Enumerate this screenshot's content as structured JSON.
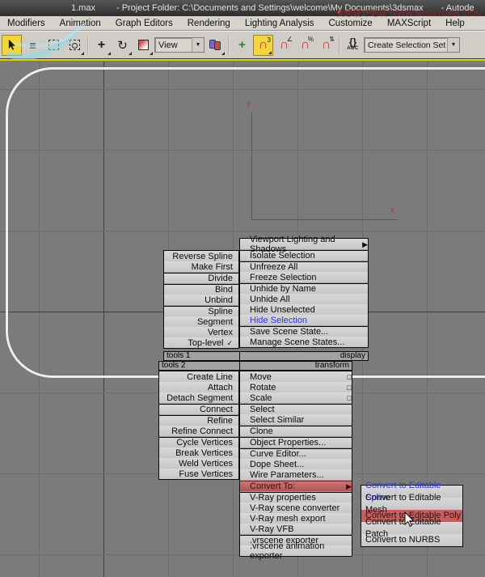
{
  "title_bar": {
    "file": "1.max",
    "project": "- Project Folder: C:\\Documents and Settings\\welcome\\My Documents\\3dsmax",
    "suffix": "- Autode",
    "watermark": "爱思设计论坛 WWW.MISSYUAN.COM"
  },
  "menu_bar": {
    "items": [
      "Modifiers",
      "Animation",
      "Graph Editors",
      "Rendering",
      "Lighting Analysis",
      "Customize",
      "MAXScript",
      "Help"
    ]
  },
  "toolbar": {
    "reference_coordsys_value": "View",
    "create_selection_set_label": "Create Selection Set",
    "icons": {
      "select_by_name": "≡",
      "move": "+",
      "rotate": "↻",
      "manipulate": "+",
      "magnet": "∩",
      "snap_3d_sup": "3",
      "angle_snap_sup": "∠",
      "percent_snap_sup": "%",
      "spinner_snap_sup": "⇅",
      "named_sets_braces": "{}",
      "named_sets_sub": "ABC",
      "dropdown_arrow": "▼"
    }
  },
  "viewport": {
    "axis_y_label": "y",
    "axis_x_label": "x",
    "colors": {
      "background": "#7b7b7b",
      "grid": "#6c6c6c",
      "grid_dark": "#3f3f3f",
      "axis_red": "#9e3a3a",
      "spline_white": "#ededed",
      "active_border_yellow": "#d6d600"
    }
  },
  "quad_menu": {
    "caption_tools1": "tools 1",
    "caption_display": "display",
    "caption_tools2": "tools 2",
    "caption_transform": "transform",
    "tools1": [
      {
        "label": "Reverse Spline",
        "right": "",
        "cls": "mi"
      },
      {
        "label": "Make First",
        "right": "",
        "cls": "mi"
      },
      {
        "label": "Divide",
        "right": "",
        "cls": "mi sep"
      },
      {
        "label": "Bind",
        "right": "",
        "cls": "mi sep"
      },
      {
        "label": "Unbind",
        "right": "",
        "cls": "mi"
      },
      {
        "label": "Spline",
        "right": "",
        "cls": "mi sep"
      },
      {
        "label": "Segment",
        "right": "",
        "cls": "mi"
      },
      {
        "label": "Vertex",
        "right": "",
        "cls": "mi"
      },
      {
        "label": "Top-level",
        "right": "✓",
        "cls": "mi"
      }
    ],
    "display": [
      {
        "label": "Viewport Lighting and Shadows",
        "right": "▶",
        "cls": "mi"
      },
      {
        "label": "Isolate Selection",
        "right": "",
        "cls": "mi sep"
      },
      {
        "label": "Unfreeze All",
        "right": "",
        "cls": "mi sep"
      },
      {
        "label": "Freeze Selection",
        "right": "",
        "cls": "mi"
      },
      {
        "label": "Unhide by Name",
        "right": "",
        "cls": "mi sep"
      },
      {
        "label": "Unhide All",
        "right": "",
        "cls": "mi"
      },
      {
        "label": "Hide Unselected",
        "right": "",
        "cls": "mi"
      },
      {
        "label": "Hide Selection",
        "right": "",
        "cls": "mi blue"
      },
      {
        "label": "Save Scene State...",
        "right": "",
        "cls": "mi sep"
      },
      {
        "label": "Manage Scene States...",
        "right": "",
        "cls": "mi"
      }
    ],
    "tools2": [
      {
        "label": "Create Line",
        "right": "",
        "cls": "mi"
      },
      {
        "label": "Attach",
        "right": "",
        "cls": "mi"
      },
      {
        "label": "Detach Segment",
        "right": "",
        "cls": "mi"
      },
      {
        "label": "Connect",
        "right": "",
        "cls": "mi sep"
      },
      {
        "label": "Refine",
        "right": "",
        "cls": "mi sep"
      },
      {
        "label": "Refine Connect",
        "right": "",
        "cls": "mi"
      },
      {
        "label": "Cycle Vertices",
        "right": "",
        "cls": "mi sep"
      },
      {
        "label": "Break Vertices",
        "right": "",
        "cls": "mi"
      },
      {
        "label": "Weld Vertices",
        "right": "",
        "cls": "mi"
      },
      {
        "label": "Fuse Vertices",
        "right": "",
        "cls": "mi"
      }
    ],
    "transform": [
      {
        "label": "Move",
        "right": "□",
        "cls": "mi"
      },
      {
        "label": "Rotate",
        "right": "□",
        "cls": "mi"
      },
      {
        "label": "Scale",
        "right": "□",
        "cls": "mi"
      },
      {
        "label": "Select",
        "right": "",
        "cls": "mi sep"
      },
      {
        "label": "Select Similar",
        "right": "",
        "cls": "mi"
      },
      {
        "label": "Clone",
        "right": "",
        "cls": "mi sep"
      },
      {
        "label": "Object Properties...",
        "right": "",
        "cls": "mi sep"
      },
      {
        "label": "Curve Editor...",
        "right": "",
        "cls": "mi sep"
      },
      {
        "label": "Dope Sheet...",
        "right": "",
        "cls": "mi"
      },
      {
        "label": "Wire Parameters...",
        "right": "",
        "cls": "mi"
      },
      {
        "label": "Convert To:",
        "right": "▶",
        "cls": "mi sep red"
      },
      {
        "label": "V-Ray properties",
        "right": "",
        "cls": "mi sep"
      },
      {
        "label": "V-Ray scene converter",
        "right": "",
        "cls": "mi"
      },
      {
        "label": "V-Ray mesh export",
        "right": "",
        "cls": "mi"
      },
      {
        "label": "V-Ray VFB",
        "right": "",
        "cls": "mi"
      },
      {
        "label": ".vrscene exporter",
        "right": "",
        "cls": "mi sep"
      },
      {
        "label": ".vrscene animation exporter",
        "right": "",
        "cls": "mi"
      }
    ],
    "convert_submenu": [
      {
        "label": "Convert to Editable Spline",
        "right": "",
        "cls": "mi blue"
      },
      {
        "label": "Convert to Editable Mesh",
        "right": "",
        "cls": "mi"
      },
      {
        "label": "Convert to Editable Poly",
        "right": "",
        "cls": "mi redsel"
      },
      {
        "label": "Convert to Editable Patch",
        "right": "",
        "cls": "mi"
      },
      {
        "label": "Convert to NURBS",
        "right": "",
        "cls": "mi"
      }
    ]
  }
}
